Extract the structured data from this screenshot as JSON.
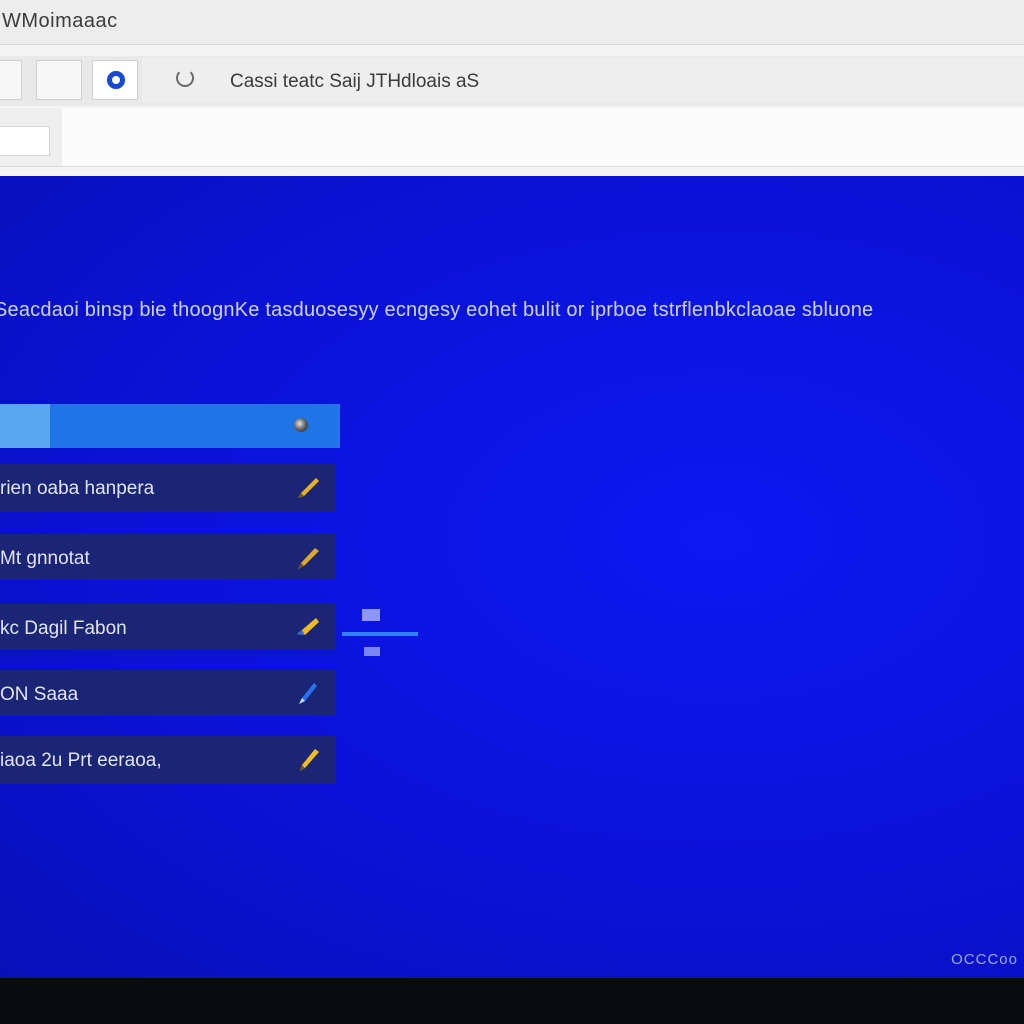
{
  "window": {
    "title": "WMoimaaac"
  },
  "toolbar": {
    "address_text": "Cassi teatc Saij JTHdloais aS"
  },
  "content": {
    "description": "Seacdaoi binsp bie thoognKe tasduosesyy ecngesy eohet bulit or iprboe tstrflenbkclaoae sbluone",
    "primary_item": {
      "label": ""
    },
    "items": [
      {
        "label": "rien oaba hanpera",
        "icon": "pen-icon"
      },
      {
        "label": "Mt gnnotat",
        "icon": "pen-icon"
      },
      {
        "label": "kc Dagil Fabon",
        "icon": "pen-icon"
      },
      {
        "label": "ON Saaa",
        "icon": "pen-icon"
      },
      {
        "label": "iaoa 2u Prt eeraoa,",
        "icon": "pen-icon"
      }
    ],
    "footer": "OCCCoo"
  },
  "colors": {
    "content_blue": "#0a12d8",
    "primary_item": "#1f74e6",
    "list_item": "#1a2575",
    "pen_gold": "#e8b21e"
  }
}
